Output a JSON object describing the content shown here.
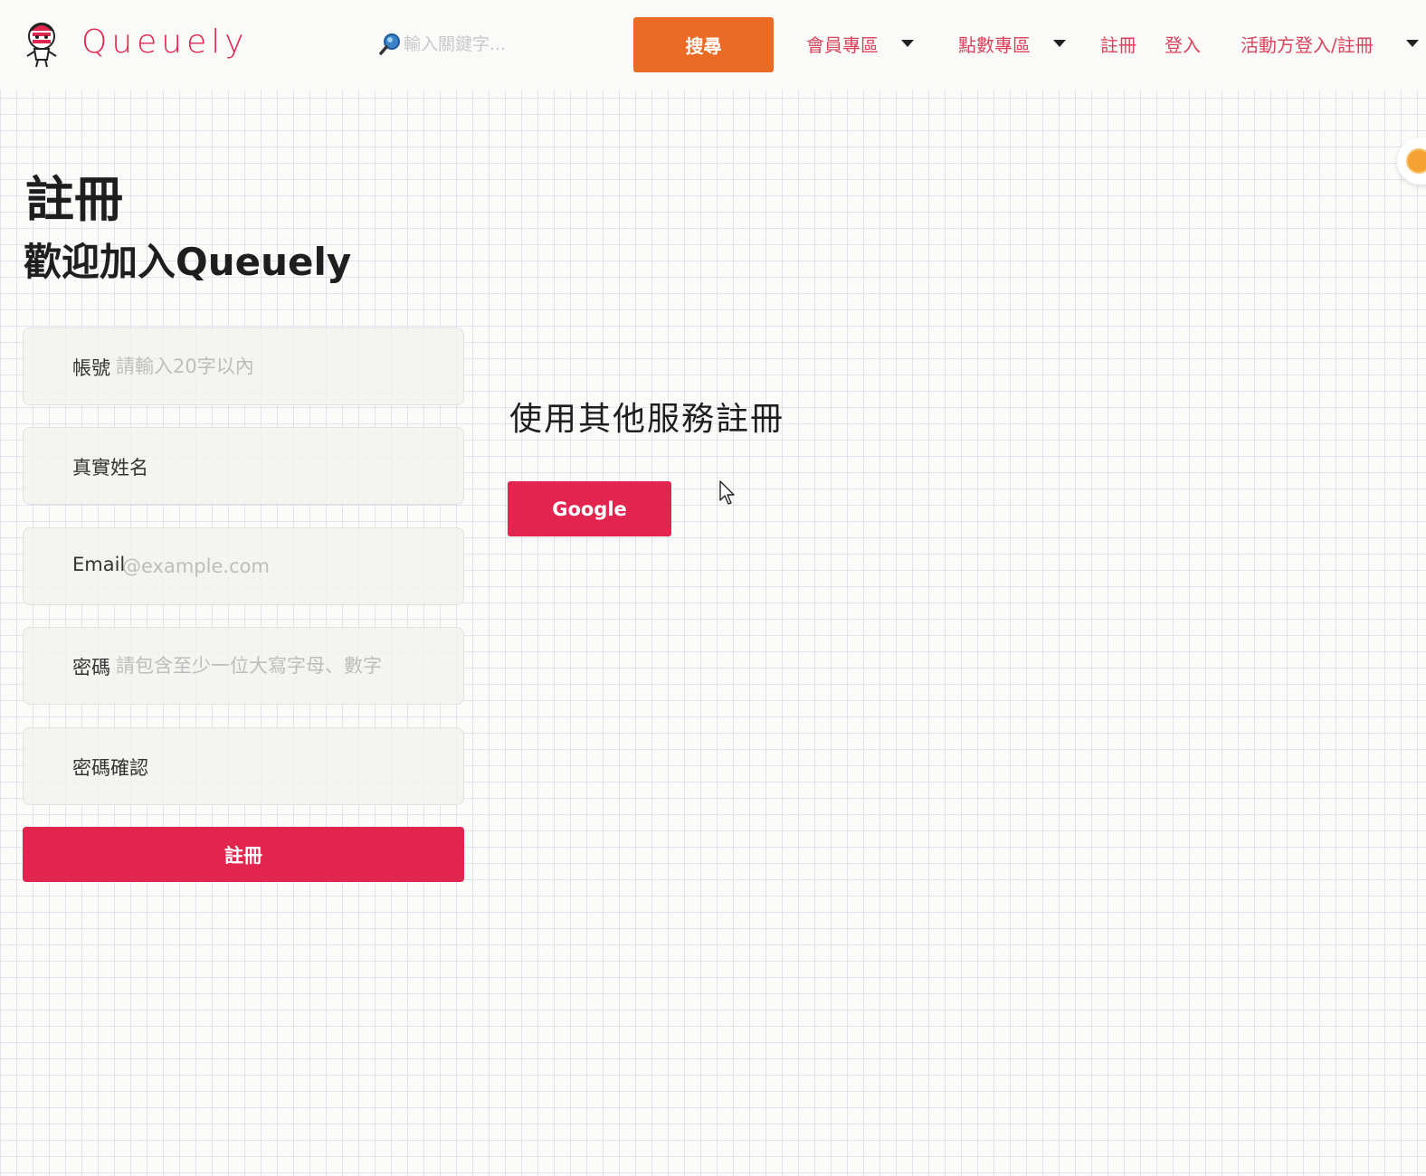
{
  "brand": {
    "name": "Queuely",
    "accent_color": "#e0264f",
    "logo_icon": "mascot-logo-icon"
  },
  "header": {
    "search": {
      "placeholder": "輸入關鍵字...",
      "value": "",
      "icon": "magnifier-icon",
      "button_label": "搜尋",
      "button_color": "#ec6b24"
    },
    "nav": {
      "member": "會員專區",
      "points": "點數專區",
      "register": "註冊",
      "login": "登入",
      "organizer": "活動方登入/註冊"
    }
  },
  "page": {
    "title": "註冊",
    "subtitle": "歡迎加入Queuely"
  },
  "form": {
    "account": {
      "label": "帳號",
      "placeholder": "請輸入20字以內",
      "value": ""
    },
    "real_name": {
      "label": "真實姓名",
      "placeholder": "",
      "value": ""
    },
    "email": {
      "label": "Email",
      "placeholder": "@example.com",
      "value": ""
    },
    "password": {
      "label": "密碼",
      "placeholder": "請包含至少一位大寫字母、數字",
      "value": ""
    },
    "password_confirm": {
      "label": "密碼確認",
      "placeholder": "",
      "value": ""
    },
    "submit_label": "註冊",
    "button_color": "#e2254f"
  },
  "other_services": {
    "title": "使用其他服務註冊",
    "google_label": "Google"
  },
  "side_badge": {
    "icon": "coin-icon"
  }
}
